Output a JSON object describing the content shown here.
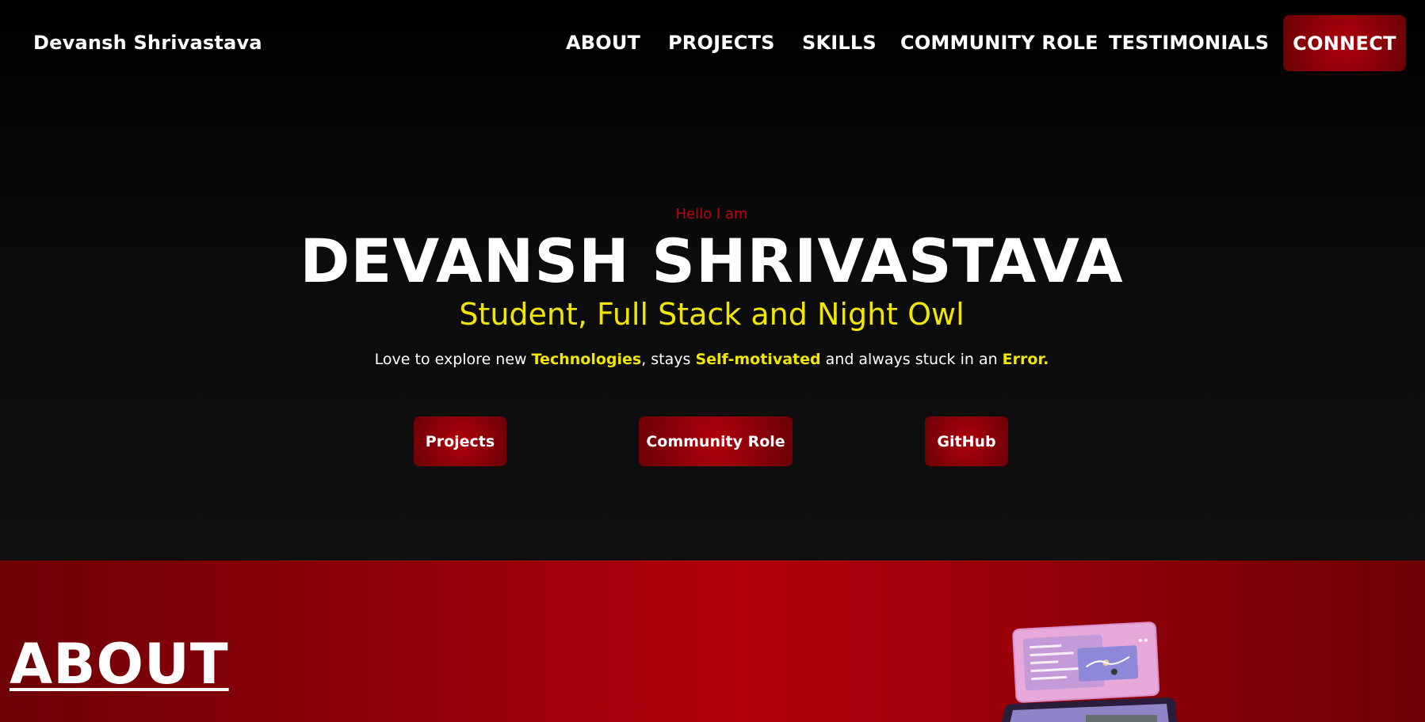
{
  "nav": {
    "brand": "Devansh Shrivastava",
    "links": [
      "ABOUT",
      "PROJECTS",
      "SKILLS",
      "COMMUNITY ROLE",
      "TESTIMONIALS"
    ],
    "connect_label": "CONNECT"
  },
  "hero": {
    "greeting": "Hello I am",
    "name": "DEVANSH SHRIVASTAVA",
    "subtitle": "Student, Full Stack and Night Owl",
    "desc_part1": "Love to explore new ",
    "desc_hl1": "Technologies",
    "desc_part2": ", stays ",
    "desc_hl2": "Self-motivated",
    "desc_part3": " and always stuck in an ",
    "desc_hl3": "Error.",
    "buttons": [
      "Projects",
      "Community Role",
      "GitHub"
    ]
  },
  "about": {
    "title": "ABOUT",
    "illustration_icon": "laptop-screens-illustration"
  },
  "colors": {
    "accent_red": "#b0000a",
    "highlight_yellow": "#f2e600",
    "background": "#0a0a0a"
  }
}
